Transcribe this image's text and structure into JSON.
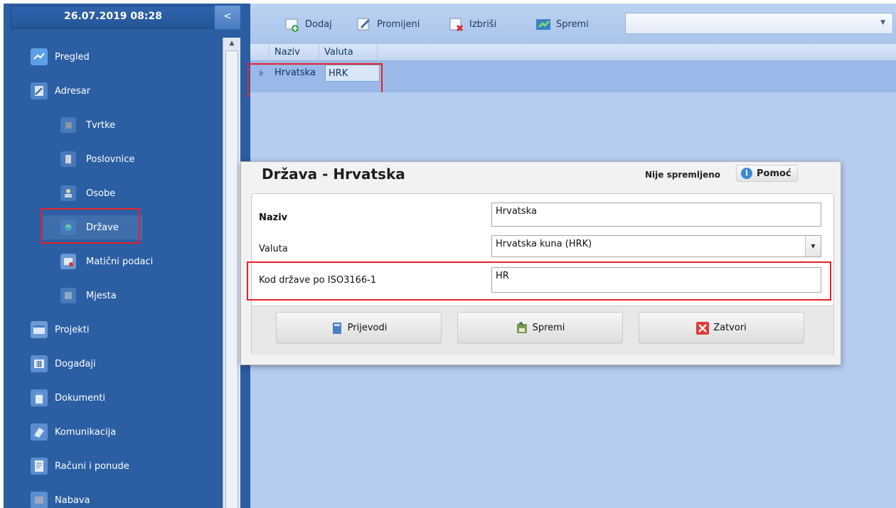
{
  "sidebar": {
    "datetime": "26.07.2019 08:28",
    "collapse_label": "<",
    "items": [
      {
        "label": "Pregled",
        "icon": "overview-icon"
      },
      {
        "label": "Adresar",
        "icon": "address-book-icon"
      },
      {
        "label": "Tvrtke",
        "icon": "companies-icon"
      },
      {
        "label": "Poslovnice",
        "icon": "branches-icon"
      },
      {
        "label": "Osobe",
        "icon": "persons-icon"
      },
      {
        "label": "Države",
        "icon": "globe-icon"
      },
      {
        "label": "Matični podaci",
        "icon": "master-data-icon"
      },
      {
        "label": "Mjesta",
        "icon": "places-icon"
      },
      {
        "label": "Projekti",
        "icon": "projects-icon"
      },
      {
        "label": "Događaji",
        "icon": "calendar-icon"
      },
      {
        "label": "Dokumenti",
        "icon": "documents-icon"
      },
      {
        "label": "Komunikacija",
        "icon": "phone-icon"
      },
      {
        "label": "Računi i ponude",
        "icon": "invoice-icon"
      },
      {
        "label": "Nabava",
        "icon": "procurement-icon"
      }
    ]
  },
  "toolbar": {
    "add_label": "Dodaj",
    "edit_label": "Promijeni",
    "delete_label": "Izbriši",
    "save_label": "Spremi",
    "filter_value": ""
  },
  "grid": {
    "columns": [
      "Naziv",
      "Valuta"
    ],
    "rows": [
      {
        "name": "Hrvatska",
        "currency": "HRK"
      }
    ]
  },
  "dialog": {
    "title": "Država - Hrvatska",
    "status": "Nije spremljeno",
    "help_label": "Pomoć",
    "fields": {
      "name_label": "Naziv",
      "name_value": "Hrvatska",
      "currency_label": "Valuta",
      "currency_value": "Hrvatska kuna (HRK)",
      "iso_label": "Kod države po ISO3166-1",
      "iso_value": "HR"
    },
    "buttons": {
      "translations": "Prijevodi",
      "save": "Spremi",
      "close": "Zatvori"
    }
  },
  "colors": {
    "sidebar_bg": "#2b5ea3",
    "main_bg": "#b5cdf0",
    "highlight": "#e8202a"
  }
}
